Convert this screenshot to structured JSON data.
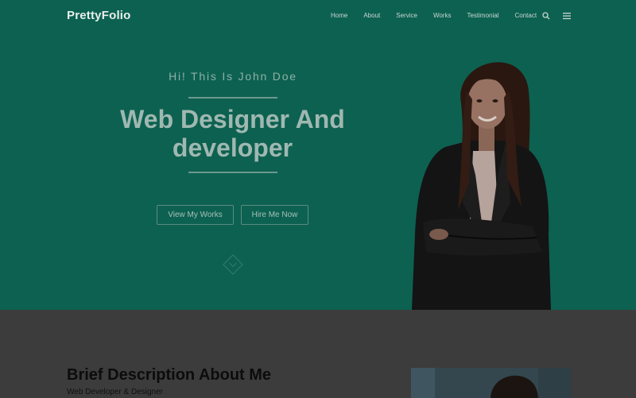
{
  "nav": {
    "logo": "PrettyFolio",
    "items": [
      "Home",
      "About",
      "Service",
      "Works",
      "Testimonial",
      "Contact"
    ],
    "search_icon": "search-icon",
    "menu_icon": "hamburger-menu-icon"
  },
  "hero": {
    "greeting": "Hi! This Is John Doe",
    "headline_line1": "Web Designer And",
    "headline_line2": "developer",
    "buttons": {
      "works_label": "View My Works",
      "hire_label": "Hire Me Now"
    },
    "scroll_icon": "diamond-chevron-down-icon"
  },
  "about": {
    "title": "Brief Description About Me",
    "subtitle": "Web Developer & Designer"
  },
  "colors": {
    "hero_bg": "#0d6150",
    "about_bg": "#3c3c3c",
    "accent": "#6d988e"
  }
}
